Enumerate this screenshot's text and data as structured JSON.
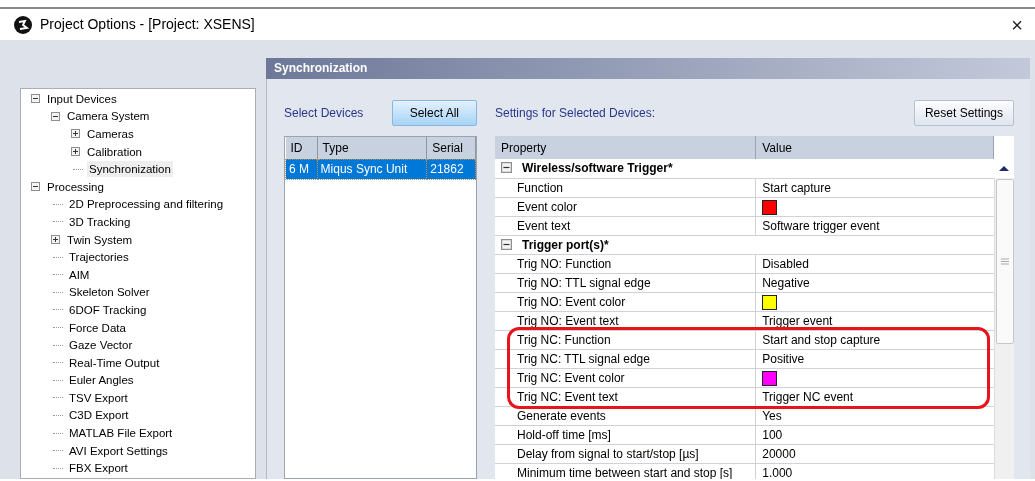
{
  "window": {
    "title": "Project Options - [Project: XSENS]",
    "close": "×"
  },
  "tree": [
    {
      "label": "Input Devices",
      "kind": "node",
      "expanded": true,
      "selected": false,
      "children": [
        {
          "label": "Camera System",
          "kind": "node",
          "expanded": true,
          "selected": false,
          "children": [
            {
              "label": "Cameras",
              "kind": "node",
              "expanded": false,
              "selected": false
            },
            {
              "label": "Calibration",
              "kind": "node",
              "expanded": false,
              "selected": false
            },
            {
              "label": "Synchronization",
              "kind": "leaf",
              "selected": true
            }
          ]
        }
      ]
    },
    {
      "label": "Processing",
      "kind": "node",
      "expanded": true,
      "selected": false,
      "children": [
        {
          "label": "2D Preprocessing and filtering",
          "kind": "leaf",
          "selected": false
        },
        {
          "label": "3D Tracking",
          "kind": "leaf",
          "selected": false
        },
        {
          "label": "Twin System",
          "kind": "node",
          "expanded": false,
          "selected": false
        },
        {
          "label": "Trajectories",
          "kind": "leaf",
          "selected": false
        },
        {
          "label": "AIM",
          "kind": "leaf",
          "selected": false
        },
        {
          "label": "Skeleton Solver",
          "kind": "leaf",
          "selected": false
        },
        {
          "label": "6DOF Tracking",
          "kind": "leaf",
          "selected": false
        },
        {
          "label": "Force Data",
          "kind": "leaf",
          "selected": false
        },
        {
          "label": "Gaze Vector",
          "kind": "leaf",
          "selected": false
        },
        {
          "label": "Real-Time Output",
          "kind": "leaf",
          "selected": false
        },
        {
          "label": "Euler Angles",
          "kind": "leaf",
          "selected": false
        },
        {
          "label": "TSV Export",
          "kind": "leaf",
          "selected": false
        },
        {
          "label": "C3D Export",
          "kind": "leaf",
          "selected": false
        },
        {
          "label": "MATLAB File Export",
          "kind": "leaf",
          "selected": false
        },
        {
          "label": "AVI Export Settings",
          "kind": "leaf",
          "selected": false
        },
        {
          "label": "FBX Export",
          "kind": "leaf",
          "selected": false
        }
      ]
    }
  ],
  "panel": {
    "title": "Synchronization",
    "select_label": "Select Devices",
    "select_all_button": "Select All",
    "settings_label": "Settings for Selected Devices:",
    "reset_button": "Reset Settings",
    "devices": {
      "columns": [
        "ID",
        "Type",
        "Serial"
      ],
      "rows": [
        {
          "cells": [
            "6 M",
            "Miqus Sync Unit",
            "21862"
          ],
          "selected": true
        }
      ]
    },
    "properties": {
      "columns": [
        "Property",
        "Value"
      ],
      "rows": [
        {
          "kind": "category",
          "property": "Wireless/software Trigger*",
          "expanded": true
        },
        {
          "kind": "text",
          "property": "Function",
          "value": "Start capture"
        },
        {
          "kind": "color",
          "property": "Event color",
          "color": "#ff0000"
        },
        {
          "kind": "text",
          "property": "Event text",
          "value": "Software trigger event"
        },
        {
          "kind": "category",
          "property": "Trigger port(s)*",
          "expanded": true
        },
        {
          "kind": "text",
          "property": "Trig NO: Function",
          "value": "Disabled"
        },
        {
          "kind": "text",
          "property": "Trig NO: TTL signal edge",
          "value": "Negative"
        },
        {
          "kind": "color",
          "property": "Trig NO: Event color",
          "color": "#ffff00"
        },
        {
          "kind": "text",
          "property": "Trig NO: Event text",
          "value": "Trigger event"
        },
        {
          "kind": "highlight_group",
          "rows": [
            {
              "kind": "text",
              "property": "Trig NC: Function",
              "value": "Start and stop capture"
            },
            {
              "kind": "text",
              "property": "Trig NC: TTL signal edge",
              "value": "Positive"
            },
            {
              "kind": "color",
              "property": "Trig NC: Event color",
              "color": "#ff00ff"
            },
            {
              "kind": "text",
              "property": "Trig NC: Event text",
              "value": "Trigger NC event"
            }
          ]
        },
        {
          "kind": "text",
          "property": "Generate events",
          "value": "Yes"
        },
        {
          "kind": "text",
          "property": "Hold-off time [ms]",
          "value": "100"
        },
        {
          "kind": "text",
          "property": "Delay from signal to start/stop [µs]",
          "value": "20000"
        },
        {
          "kind": "text",
          "property": "Minimum time between start and stop [s]",
          "value": "1.000"
        }
      ]
    }
  }
}
